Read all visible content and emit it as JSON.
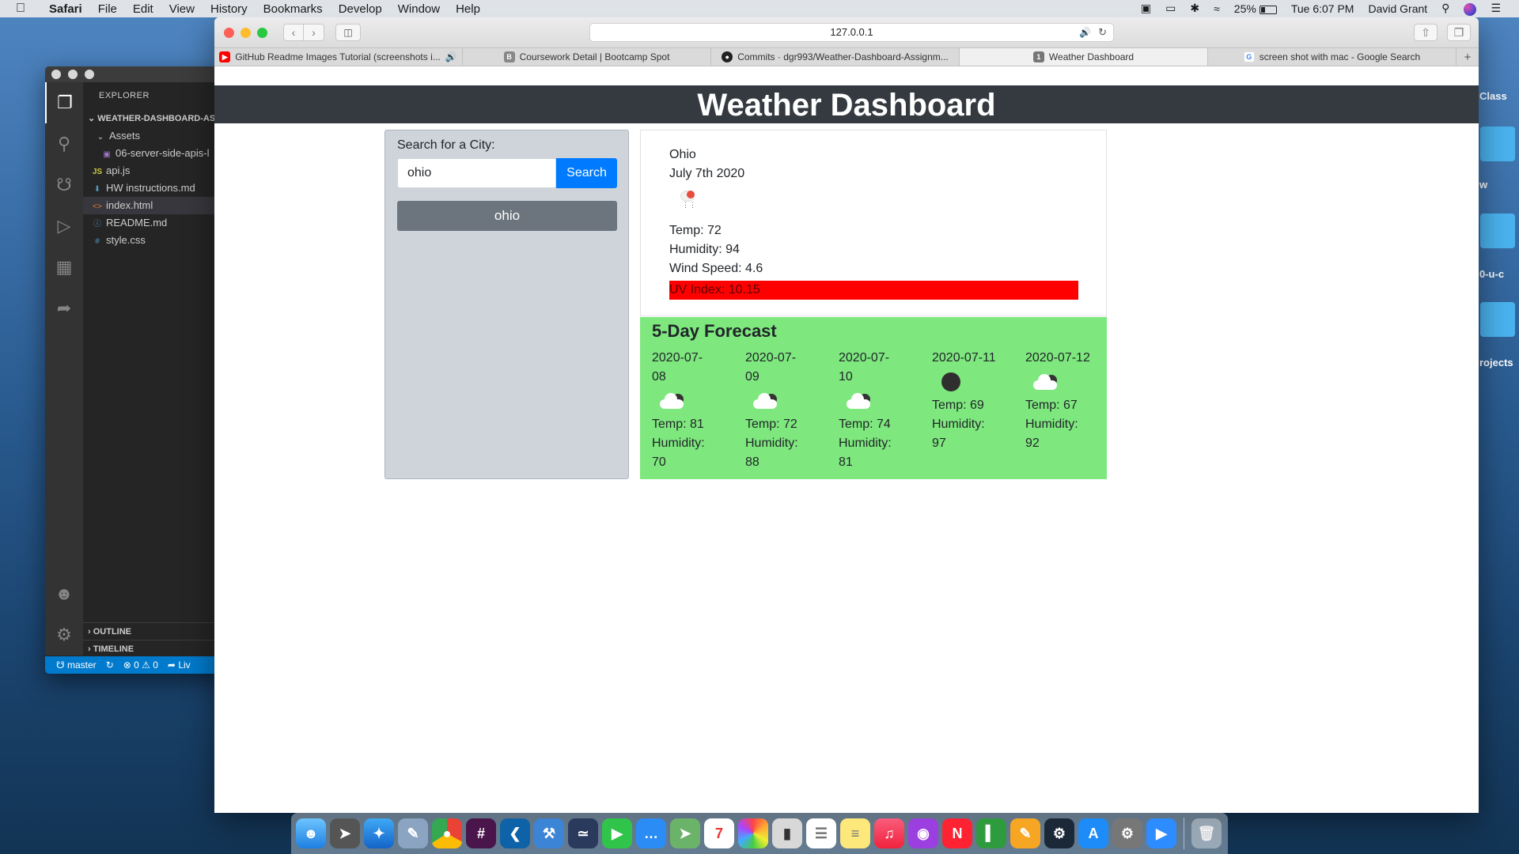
{
  "menubar": {
    "app": "Safari",
    "items": [
      "File",
      "Edit",
      "View",
      "History",
      "Bookmarks",
      "Develop",
      "Window",
      "Help"
    ],
    "battery": "25%",
    "clock": "Tue 6:07 PM",
    "user": "David Grant"
  },
  "vscode": {
    "explorer_title": "EXPLORER",
    "folder": "WEATHER-DASHBOARD-AS",
    "tree": {
      "assets": "Assets",
      "asset_file": "06-server-side-apis-l",
      "api": "api.js",
      "hw": "HW instructions.md",
      "index": "index.html",
      "readme": "README.md",
      "style": "style.css"
    },
    "outline": "OUTLINE",
    "timeline": "TIMELINE",
    "status": {
      "branch": "master",
      "problems": "⊗ 0 ⚠ 0",
      "live": "Liv"
    }
  },
  "safari": {
    "url": "127.0.0.1",
    "tabs": [
      "GitHub Readme Images Tutorial (screenshots i...",
      "Coursework Detail | Bootcamp Spot",
      "Commits · dgr993/Weather-Dashboard-Assignm...",
      "Weather Dashboard",
      "screen shot with mac - Google Search"
    ]
  },
  "page": {
    "title": "Weather Dashboard",
    "search": {
      "label": "Search for a City:",
      "value": "ohio",
      "button": "Search",
      "history": [
        "ohio"
      ]
    },
    "current": {
      "city": "Ohio",
      "date": "July 7th 2020",
      "temp": "Temp: 72",
      "humidity": "Humidity: 94",
      "wind": "Wind Speed: 4.6",
      "uv": "UV Index: 10.15",
      "uv_color": "#ff0000"
    },
    "forecast": {
      "title": "5-Day Forecast",
      "bg_color": "#7ee87e",
      "days": [
        {
          "date_a": "2020-07-",
          "date_b": "08",
          "icon": "cloudy-night-icon",
          "temp": "Temp: 81",
          "humidity_a": "Humidity:",
          "humidity_b": "70"
        },
        {
          "date_a": "2020-07-",
          "date_b": "09",
          "icon": "cloudy-night-icon",
          "temp": "Temp: 72",
          "humidity_a": "Humidity:",
          "humidity_b": "88"
        },
        {
          "date_a": "2020-07-",
          "date_b": "10",
          "icon": "cloudy-night-icon",
          "temp": "Temp: 74",
          "humidity_a": "Humidity:",
          "humidity_b": "81"
        },
        {
          "date_a": "2020-07-11",
          "icon": "clear-night-icon",
          "temp": "Temp: 69",
          "humidity_a": "Humidity:",
          "humidity_b": "97"
        },
        {
          "date_a": "2020-07-12",
          "icon": "cloudy-night-icon",
          "temp": "Temp: 67",
          "humidity_a": "Humidity:",
          "humidity_b": "92"
        }
      ]
    }
  },
  "desktop": {
    "labels": [
      "Class",
      "w",
      "0-u-c",
      "rojects"
    ]
  }
}
